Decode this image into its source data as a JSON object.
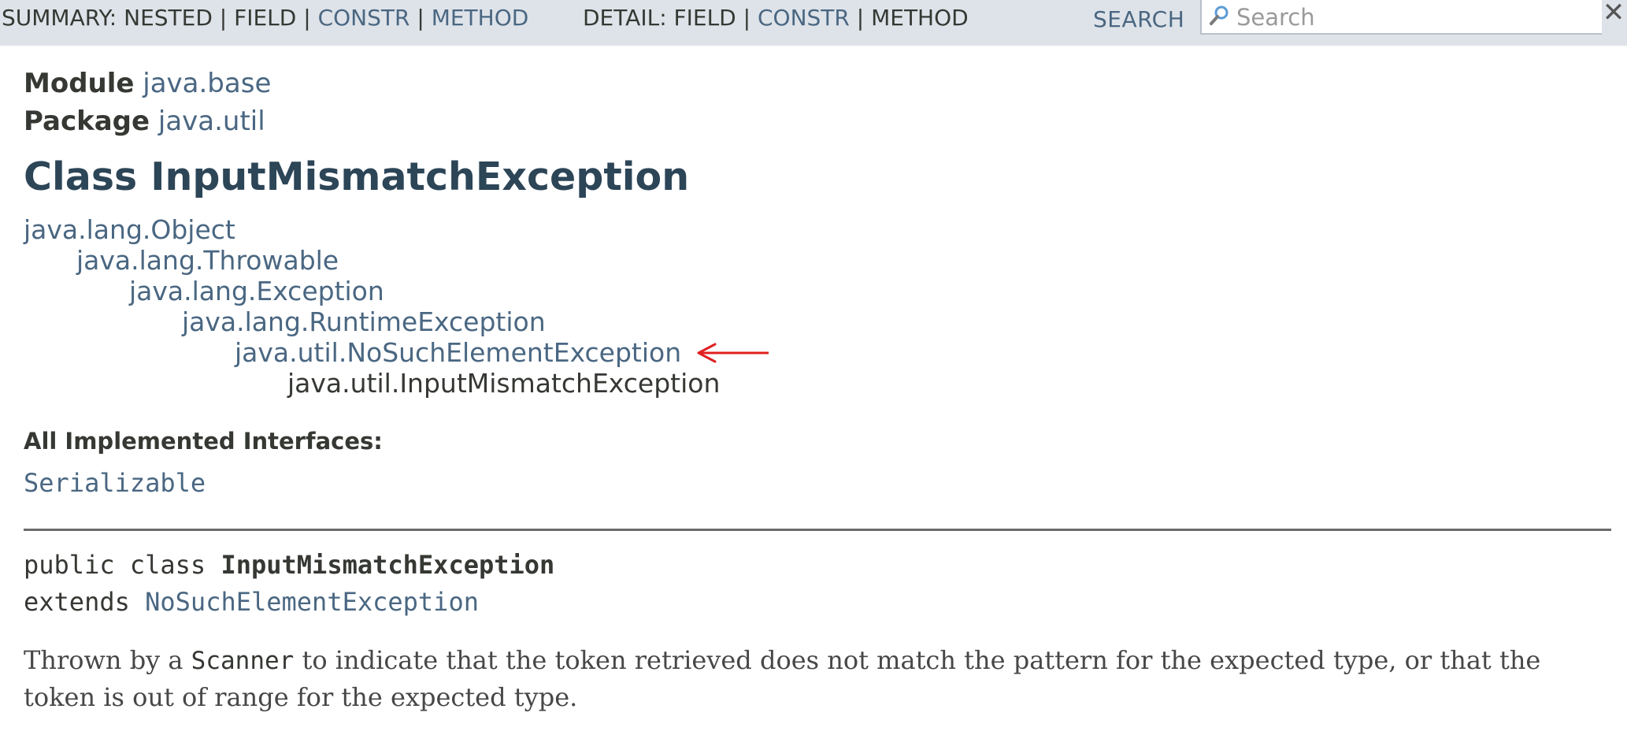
{
  "subnav": {
    "summary_label": "SUMMARY: ",
    "summary_nested": "NESTED",
    "summary_field": "FIELD",
    "summary_constr": "CONSTR",
    "summary_method": "METHOD",
    "detail_label": "DETAIL: ",
    "detail_field": "FIELD",
    "detail_constr": "CONSTR",
    "detail_method": "METHOD",
    "separator": " | ",
    "search_label": "SEARCH",
    "search_placeholder": "Search",
    "reset_glyph": "✕"
  },
  "header": {
    "module_label": "Module",
    "module_value": "java.base",
    "package_label": "Package",
    "package_value": "java.util",
    "class_title": "Class InputMismatchException"
  },
  "inheritance": [
    {
      "text": "java.lang.Object",
      "link": true
    },
    {
      "text": "java.lang.Throwable",
      "link": true
    },
    {
      "text": "java.lang.Exception",
      "link": true
    },
    {
      "text": "java.lang.RuntimeException",
      "link": true
    },
    {
      "text": "java.util.NoSuchElementException",
      "link": true
    },
    {
      "text": "java.util.InputMismatchException",
      "link": false
    }
  ],
  "interfaces": {
    "label": "All Implemented Interfaces:",
    "items": [
      "Serializable"
    ]
  },
  "signature": {
    "prefix": "public class ",
    "class_name": "InputMismatchException",
    "extends_kw": "extends ",
    "extends_name": "NoSuchElementException"
  },
  "description": {
    "before": "Thrown by a ",
    "code": "Scanner",
    "after": " to indicate that the token retrieved does not match the pattern for the expected type, or that the token is out of range for the expected type."
  },
  "colors": {
    "link": "#4a6782",
    "title": "#2c4557",
    "nav_bg": "#dee3e9",
    "annotation_arrow": "#e02020"
  }
}
